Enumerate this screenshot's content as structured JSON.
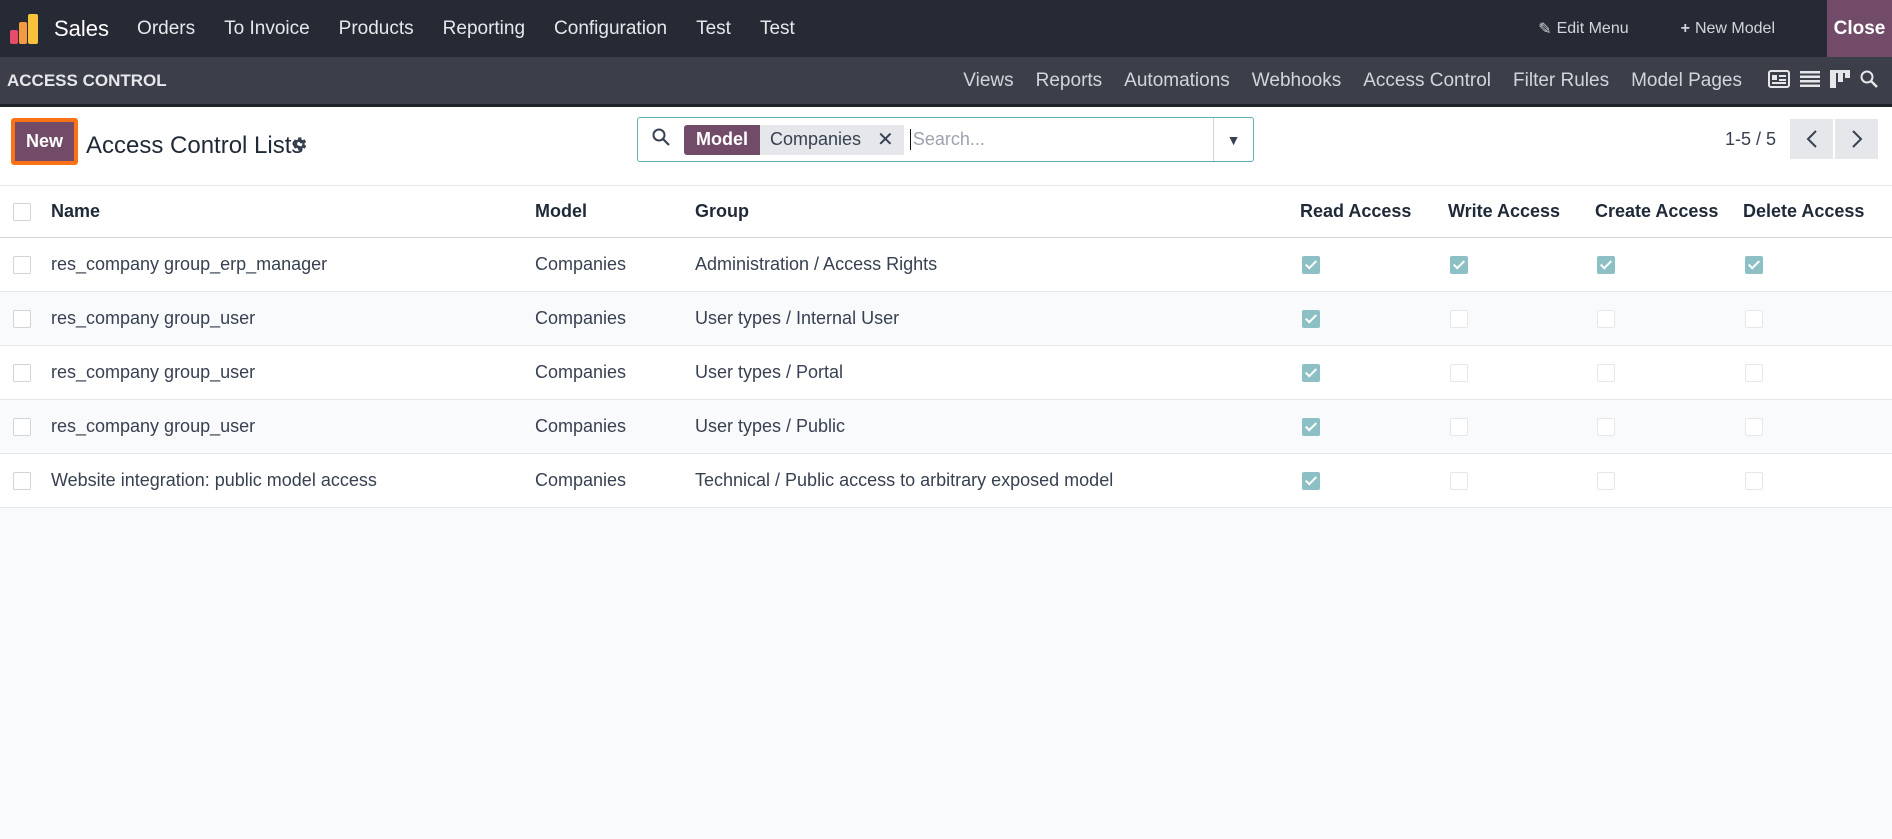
{
  "topbar": {
    "app_name": "Sales",
    "nav": [
      "Orders",
      "To Invoice",
      "Products",
      "Reporting",
      "Configuration",
      "Test",
      "Test"
    ],
    "edit_menu": "Edit Menu",
    "new_model": "New Model",
    "close": "Close"
  },
  "subbar": {
    "section": "ACCESS CONTROL",
    "nav": [
      "Views",
      "Reports",
      "Automations",
      "Webhooks",
      "Access Control",
      "Filter Rules",
      "Model Pages"
    ]
  },
  "control": {
    "new_label": "New",
    "title": "Access Control Lists",
    "search": {
      "facet_key": "Model",
      "facet_value": "Companies",
      "placeholder": "Search..."
    },
    "pager": "1-5 / 5"
  },
  "table": {
    "headers": [
      "Name",
      "Model",
      "Group",
      "Read Access",
      "Write Access",
      "Create Access",
      "Delete Access"
    ],
    "rows": [
      {
        "name": "res_company group_erp_manager",
        "model": "Companies",
        "group": "Administration / Access Rights",
        "read": true,
        "write": true,
        "create": true,
        "delete": true
      },
      {
        "name": "res_company group_user",
        "model": "Companies",
        "group": "User types / Internal User",
        "read": true,
        "write": false,
        "create": false,
        "delete": false
      },
      {
        "name": "res_company group_user",
        "model": "Companies",
        "group": "User types / Portal",
        "read": true,
        "write": false,
        "create": false,
        "delete": false
      },
      {
        "name": "res_company group_user",
        "model": "Companies",
        "group": "User types / Public",
        "read": true,
        "write": false,
        "create": false,
        "delete": false
      },
      {
        "name": "Website integration: public model access",
        "model": "Companies",
        "group": "Technical / Public access to arbitrary exposed model",
        "read": true,
        "write": false,
        "create": false,
        "delete": false
      }
    ]
  },
  "colors": {
    "brand": "#714b67",
    "topbar": "#262a34",
    "subbar": "#3c3f49",
    "checkbox_on": "#8cc0c4",
    "highlight": "#f97316"
  },
  "icons": {
    "edit_menu": "pencil-icon",
    "new_model": "plus-icon",
    "settings": "gear-icon",
    "search": "search-icon",
    "dropdown": "caret-down-icon"
  }
}
